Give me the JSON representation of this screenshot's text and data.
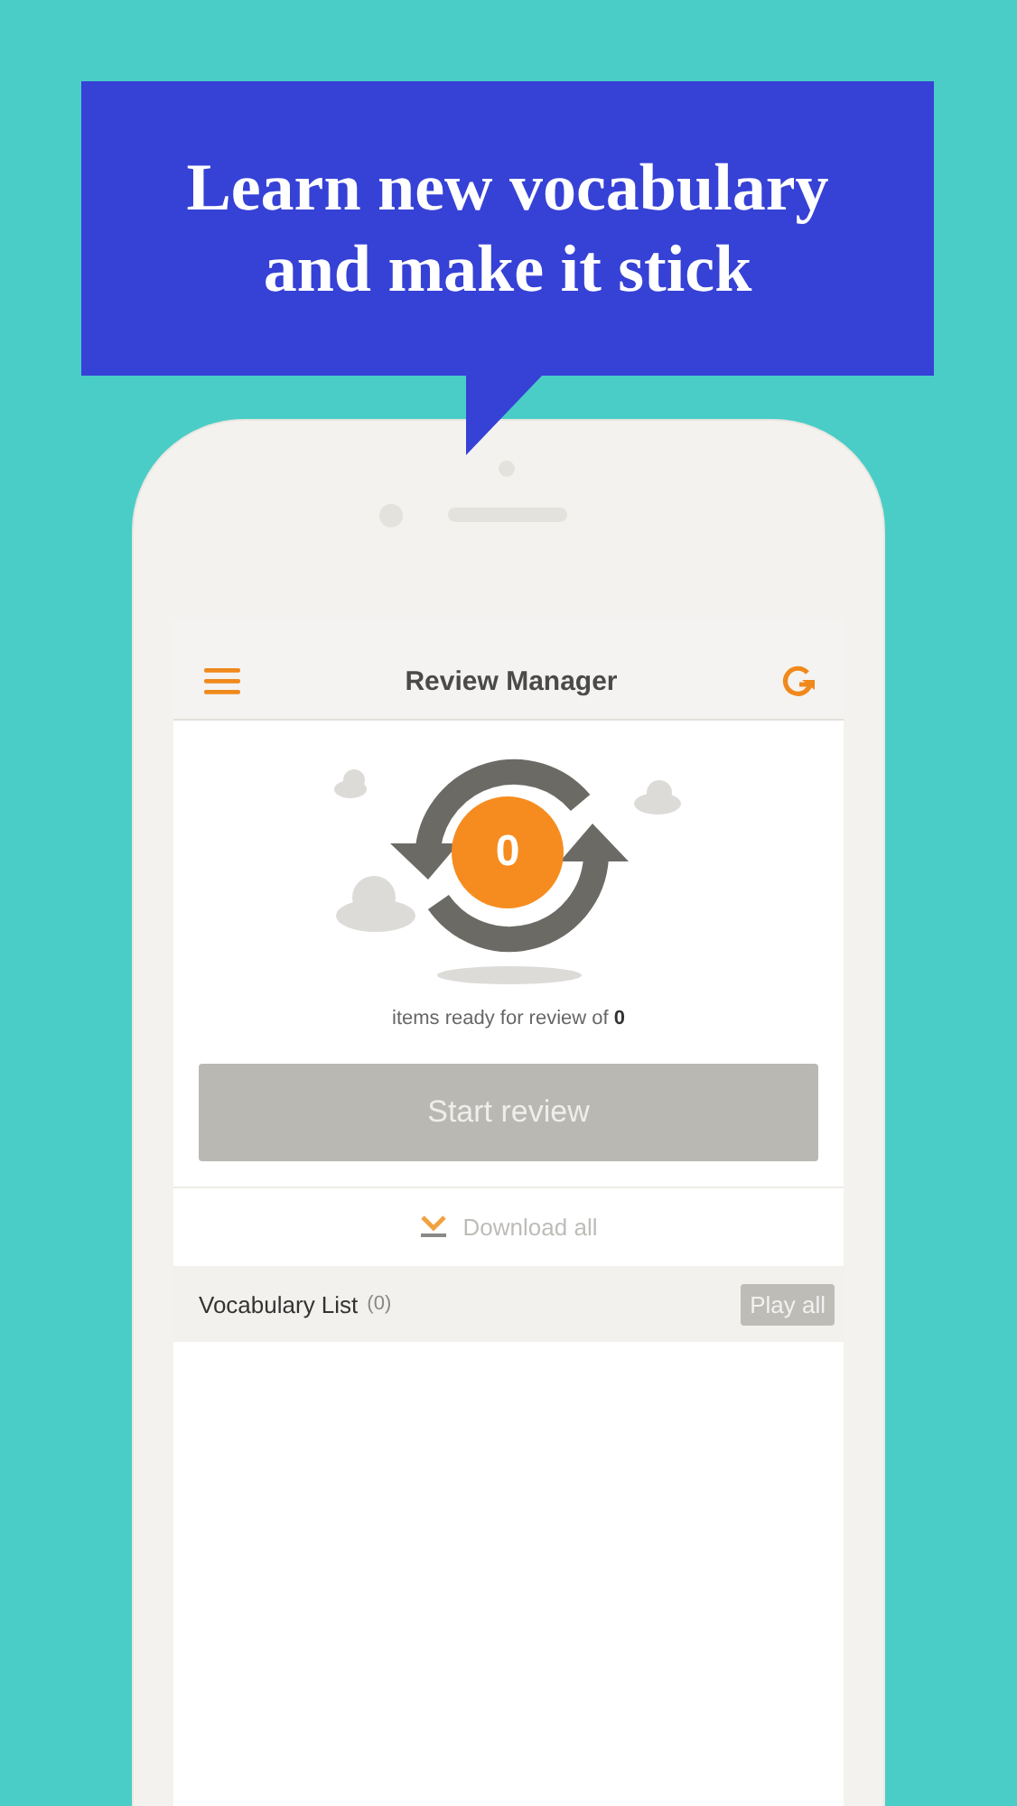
{
  "promo": {
    "headline": "Learn new vocabulary\nand make it stick"
  },
  "app_bar": {
    "title": "Review Manager"
  },
  "review": {
    "count": "0",
    "caption": "items ready for review of **0**",
    "start_button": {
      "label": "Start review",
      "disabled": true
    }
  },
  "download": {
    "label": "Download all",
    "disabled": true
  },
  "vocabulary": {
    "title": "Vocabulary List",
    "count": "(0)",
    "play_button": {
      "label": "Play all",
      "disabled": true
    }
  }
}
